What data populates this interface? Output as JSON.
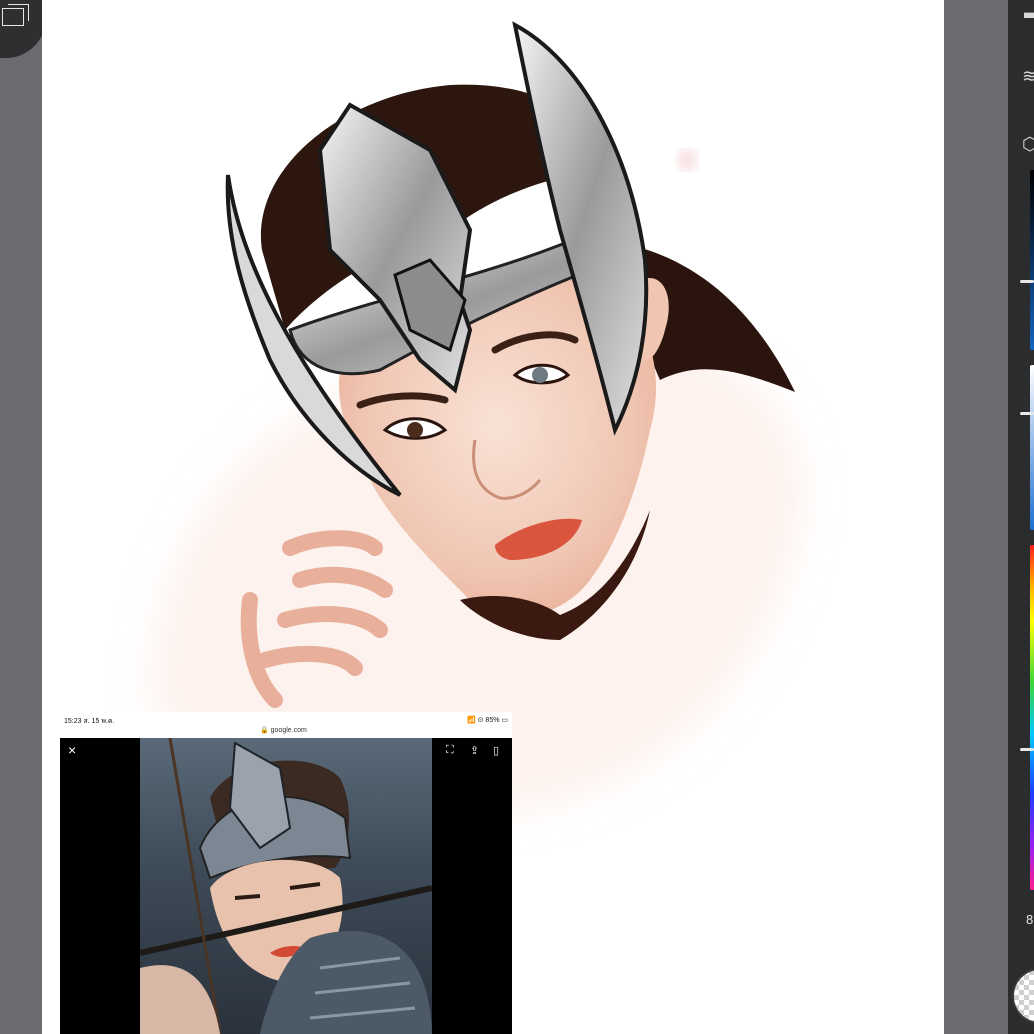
{
  "reference": {
    "status_time": "15:23  ส. 15 พ.ค.",
    "url": "🔒 google.com",
    "battery": "📶 ⊙ 85% ▭",
    "close_glyph": "×",
    "icons": [
      "screenshot-icon",
      "share-icon",
      "bookmark-icon"
    ]
  },
  "right_panel": {
    "partial_label": "8"
  },
  "colors": {
    "canvas": "#ffffff",
    "gutter": "#6b6d71",
    "panel": "#2b2c2e",
    "hair": "#2a140d",
    "skin": "#f3d3c4",
    "helmet": "#b9b9b9"
  }
}
